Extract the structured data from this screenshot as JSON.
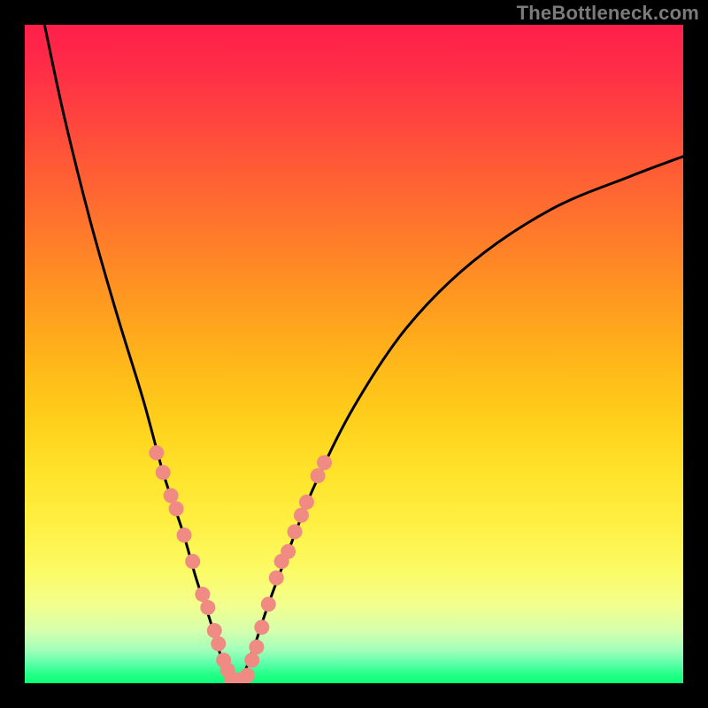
{
  "watermark": "TheBottleneck.com",
  "chart_data": {
    "type": "line",
    "title": "",
    "xlabel": "",
    "ylabel": "",
    "xlim": [
      0,
      100
    ],
    "ylim": [
      0,
      100
    ],
    "grid": false,
    "legend": false,
    "series": [
      {
        "name": "bottleneck-curve",
        "color": "#000000",
        "x": [
          3,
          6,
          10,
          14,
          18,
          21,
          24,
          26,
          28,
          29.5,
          30.5,
          31.5,
          32.5,
          33.5,
          35,
          37,
          40,
          44,
          50,
          58,
          68,
          80,
          92,
          100
        ],
        "y": [
          100,
          86,
          70,
          56,
          43,
          32,
          23,
          16,
          10,
          5,
          2,
          0.5,
          0.5,
          2,
          6,
          12,
          20,
          30,
          42,
          54,
          64,
          72,
          77,
          80
        ]
      }
    ],
    "markers": [
      {
        "name": "left-branch-dots",
        "color": "#ef8b82",
        "shape": "circle",
        "x": [
          20.0,
          21.0,
          22.2,
          23.0,
          24.2,
          25.5,
          27.0,
          27.8,
          28.8,
          29.4,
          30.2,
          30.8
        ],
        "y": [
          35.0,
          32.0,
          28.5,
          26.5,
          22.5,
          18.5,
          13.5,
          11.5,
          8.0,
          6.0,
          3.5,
          2.0
        ]
      },
      {
        "name": "trough-dots",
        "color": "#ef8b82",
        "shape": "circle",
        "x": [
          31.4,
          32.2,
          33.0,
          33.8
        ],
        "y": [
          0.7,
          0.5,
          0.5,
          1.2
        ]
      },
      {
        "name": "right-branch-dots",
        "color": "#ef8b82",
        "shape": "circle",
        "x": [
          34.5,
          35.2,
          36.0,
          37.0,
          38.2,
          39.0,
          40.0,
          41.0,
          42.0,
          42.8,
          44.5,
          45.5
        ],
        "y": [
          3.5,
          5.5,
          8.5,
          12.0,
          16.0,
          18.5,
          20.0,
          23.0,
          25.5,
          27.5,
          31.5,
          33.5
        ]
      }
    ]
  }
}
